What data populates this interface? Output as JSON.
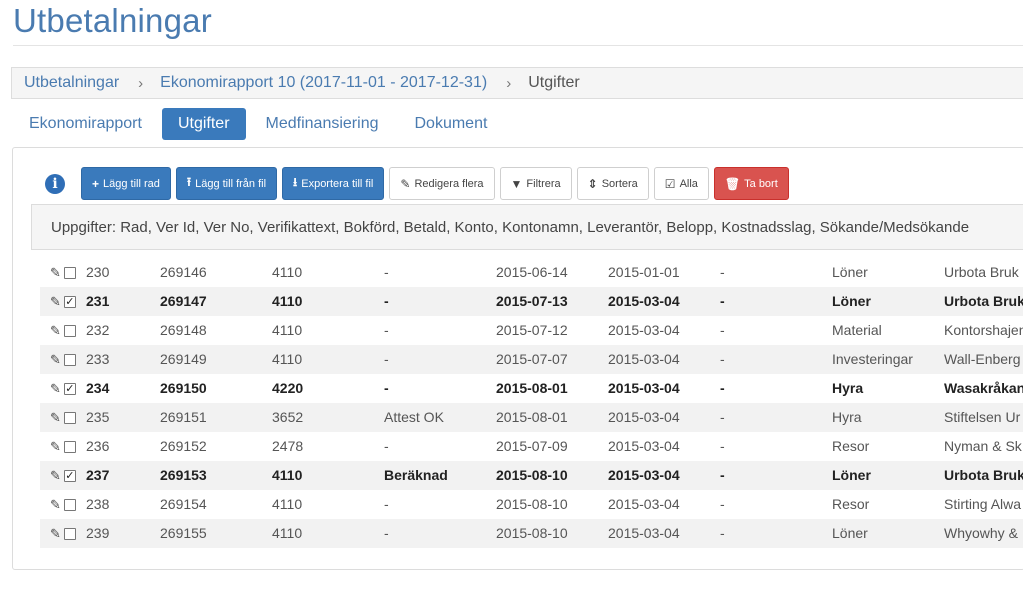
{
  "page": {
    "title": "Utbetalningar"
  },
  "breadcrumb": [
    {
      "label": "Utbetalningar",
      "link": true
    },
    {
      "label": "Ekonomirapport 10 (2017-11-01 - 2017-12-31)",
      "link": true
    },
    {
      "label": "Utgifter",
      "link": false
    }
  ],
  "breadcrumb_separator": "›",
  "tabs": [
    {
      "label": "Ekonomirapport",
      "active": false
    },
    {
      "label": "Utgifter",
      "active": true
    },
    {
      "label": "Medfinansiering",
      "active": false
    },
    {
      "label": "Dokument",
      "active": false
    }
  ],
  "toolbar": {
    "add_row": "Lägg till rad",
    "add_from_file": "Lägg till från fil",
    "export_to_file": "Exportera till fil",
    "edit_multiple": "Redigera flera",
    "filter": "Filtrera",
    "sort": "Sortera",
    "all": "Alla",
    "delete": "Ta bort"
  },
  "columns_info": "Uppgifter: Rad, Ver Id, Ver No, Verifikattext, Bokförd, Betald, Konto, Kontonamn, Leverantör, Belopp, Kostnadsslag, Sökande/Medsökande",
  "rows": [
    {
      "rad": "230",
      "ver_id": "269146",
      "ver_no": "4110",
      "text": "-",
      "bokford": "2015-06-14",
      "betald": "2015-01-01",
      "konto": "-",
      "kontonamn": "Löner",
      "leverantor": "Urbota Bruk",
      "checked": false
    },
    {
      "rad": "231",
      "ver_id": "269147",
      "ver_no": "4110",
      "text": "-",
      "bokford": "2015-07-13",
      "betald": "2015-03-04",
      "konto": "-",
      "kontonamn": "Löner",
      "leverantor": "Urbota Bruk",
      "checked": true
    },
    {
      "rad": "232",
      "ver_id": "269148",
      "ver_no": "4110",
      "text": "-",
      "bokford": "2015-07-12",
      "betald": "2015-03-04",
      "konto": "-",
      "kontonamn": "Material",
      "leverantor": "Kontorshajen",
      "checked": false
    },
    {
      "rad": "233",
      "ver_id": "269149",
      "ver_no": "4110",
      "text": "-",
      "bokford": "2015-07-07",
      "betald": "2015-03-04",
      "konto": "-",
      "kontonamn": "Investeringar",
      "leverantor": "Wall-Enberg",
      "checked": false
    },
    {
      "rad": "234",
      "ver_id": "269150",
      "ver_no": "4220",
      "text": "-",
      "bokford": "2015-08-01",
      "betald": "2015-03-04",
      "konto": "-",
      "kontonamn": "Hyra",
      "leverantor": "Wasakråkan",
      "checked": true
    },
    {
      "rad": "235",
      "ver_id": "269151",
      "ver_no": "3652",
      "text": "Attest OK",
      "bokford": "2015-08-01",
      "betald": "2015-03-04",
      "konto": "-",
      "kontonamn": "Hyra",
      "leverantor": "Stiftelsen Ur",
      "checked": false
    },
    {
      "rad": "236",
      "ver_id": "269152",
      "ver_no": "2478",
      "text": "-",
      "bokford": "2015-07-09",
      "betald": "2015-03-04",
      "konto": "-",
      "kontonamn": "Resor",
      "leverantor": "Nyman & Sk",
      "checked": false
    },
    {
      "rad": "237",
      "ver_id": "269153",
      "ver_no": "4110",
      "text": "Beräknad",
      "bokford": "2015-08-10",
      "betald": "2015-03-04",
      "konto": "-",
      "kontonamn": "Löner",
      "leverantor": "Urbota Bruk",
      "checked": true
    },
    {
      "rad": "238",
      "ver_id": "269154",
      "ver_no": "4110",
      "text": "-",
      "bokford": "2015-08-10",
      "betald": "2015-03-04",
      "konto": "-",
      "kontonamn": "Resor",
      "leverantor": "Stirting Alwa",
      "checked": false
    },
    {
      "rad": "239",
      "ver_id": "269155",
      "ver_no": "4110",
      "text": "-",
      "bokford": "2015-08-10",
      "betald": "2015-03-04",
      "konto": "-",
      "kontonamn": "Löner",
      "leverantor": "Whyowhy &",
      "checked": false
    }
  ],
  "colors": {
    "accent": "#3a7abc",
    "link": "#4a7bb0",
    "danger": "#d9534f"
  }
}
